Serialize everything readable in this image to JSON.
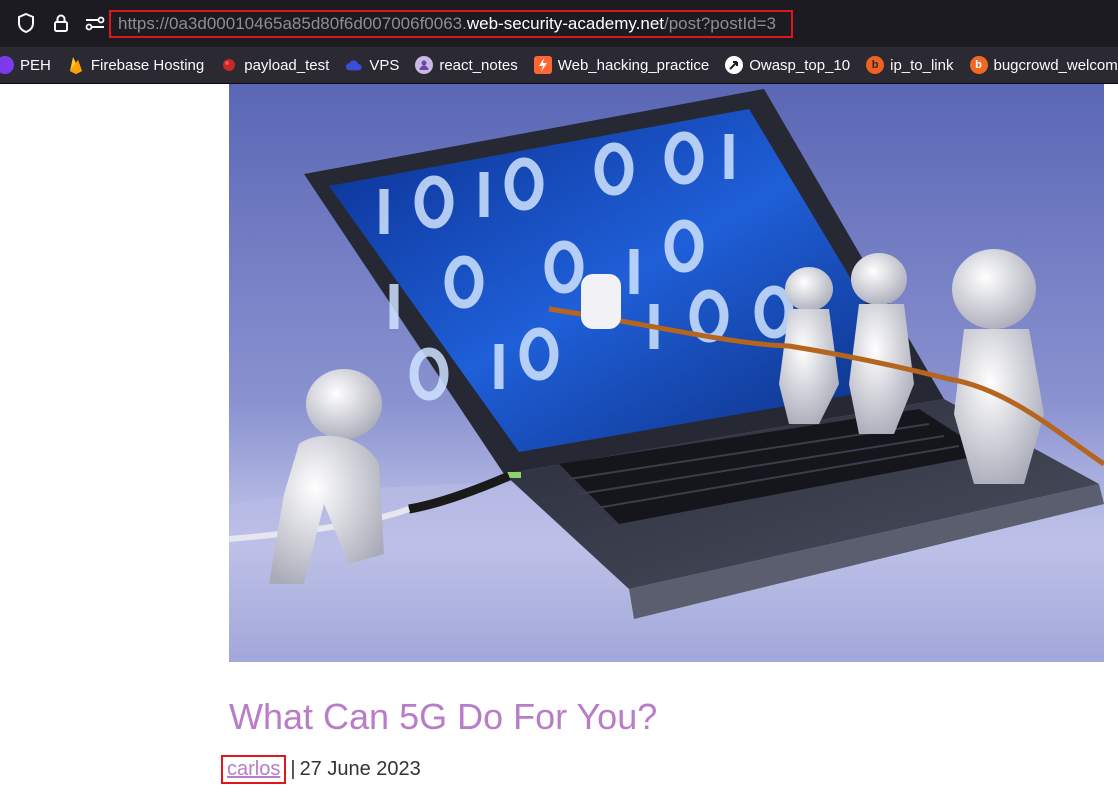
{
  "browser": {
    "url_prefix": "https://0a3d00010465a85d80f6d007006f0063.",
    "url_domain": "web-security-academy.net",
    "url_path": "/post?postId=3",
    "bookmarks": [
      {
        "label": "PEH",
        "icon": "peh-icon"
      },
      {
        "label": "Firebase Hosting",
        "icon": "firebase-icon"
      },
      {
        "label": "payload_test",
        "icon": "payload-icon"
      },
      {
        "label": "VPS",
        "icon": "cloud-icon"
      },
      {
        "label": "react_notes",
        "icon": "notes-icon"
      },
      {
        "label": "Web_hacking_practice",
        "icon": "burp-icon"
      },
      {
        "label": "Owasp_top_10",
        "icon": "owasp-icon"
      },
      {
        "label": "ip_to_link",
        "icon": "bitly-icon"
      },
      {
        "label": "bugcrowd_welcome",
        "icon": "bugcrowd-icon"
      }
    ]
  },
  "post": {
    "title": "What Can 5G Do For You?",
    "author": "carlos",
    "separator": "|",
    "date": "27 June 2023"
  },
  "colors": {
    "title": "#b97cc8",
    "highlight": "#e0171a"
  }
}
